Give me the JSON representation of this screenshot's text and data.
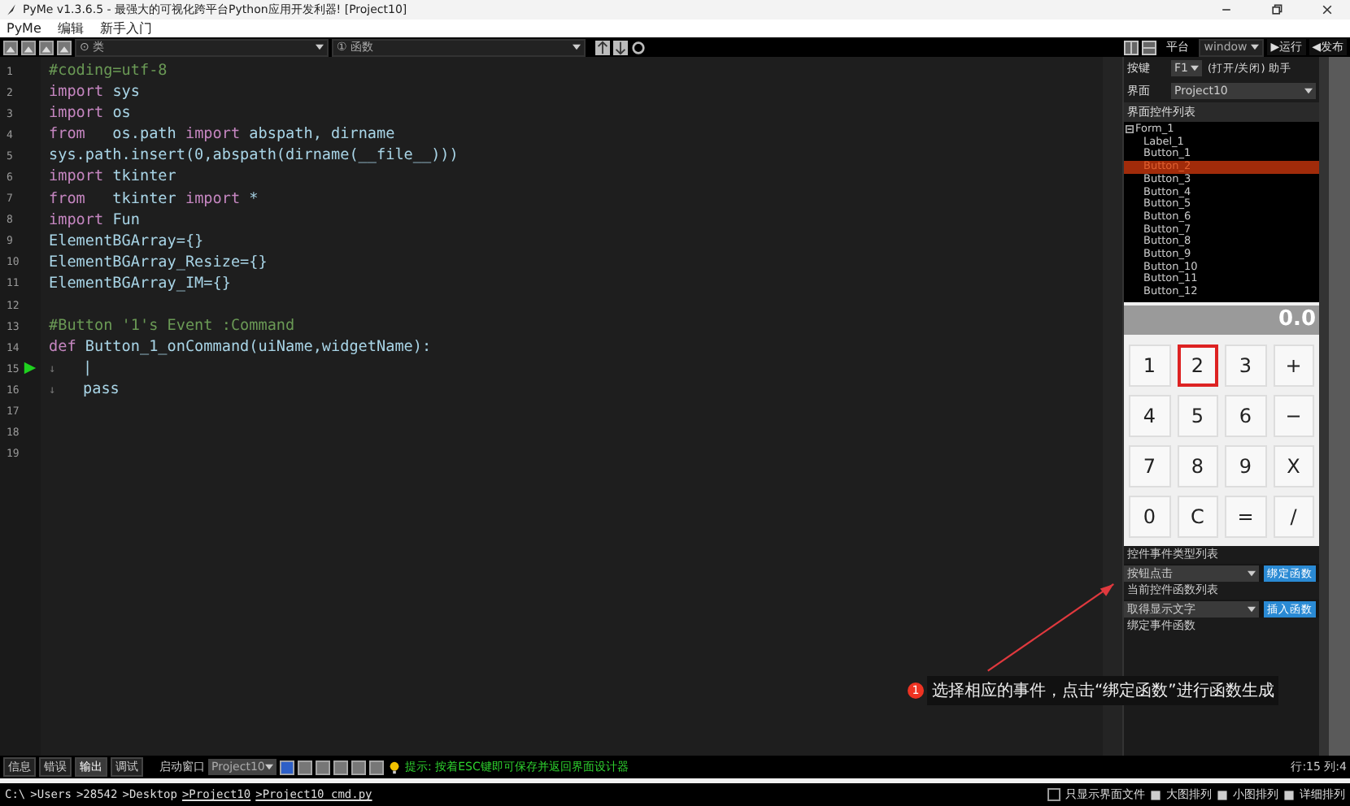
{
  "window": {
    "title": "PyMe v1.3.6.5 - 最强大的可视化跨平台Python应用开发利器!  [Project10]"
  },
  "menu": [
    "PyMe",
    "编辑",
    "新手入门"
  ],
  "toolbar": {
    "class_select": "⊙ 类",
    "function_select": "① 函数",
    "platform_label": "平台",
    "platform": "window",
    "run": "▶运行",
    "publish": "◀发布"
  },
  "editor": {
    "lines": [
      {
        "number": "1",
        "current": false,
        "code": [
          {
            "t": "#coding=utf-8",
            "kind": "comment"
          }
        ]
      },
      {
        "number": "2",
        "current": false,
        "code": [
          {
            "t": "import",
            "kind": "keyword"
          },
          {
            "t": " sys",
            "kind": "text"
          }
        ]
      },
      {
        "number": "3",
        "current": false,
        "code": [
          {
            "t": "import",
            "kind": "keyword"
          },
          {
            "t": " os",
            "kind": "text"
          }
        ]
      },
      {
        "number": "4",
        "current": false,
        "code": [
          {
            "t": "from",
            "kind": "keyword"
          },
          {
            "t": "   os.path ",
            "kind": "text"
          },
          {
            "t": "import",
            "kind": "keyword"
          },
          {
            "t": " abspath, dirname",
            "kind": "text"
          }
        ]
      },
      {
        "number": "5",
        "current": false,
        "code": [
          {
            "t": "sys.path.insert(0,abspath(dirname(__file__)))",
            "kind": "text"
          }
        ]
      },
      {
        "number": "6",
        "current": false,
        "code": [
          {
            "t": "import",
            "kind": "keyword"
          },
          {
            "t": " tkinter",
            "kind": "text"
          }
        ]
      },
      {
        "number": "7",
        "current": false,
        "code": [
          {
            "t": "from",
            "kind": "keyword"
          },
          {
            "t": "   tkinter ",
            "kind": "text"
          },
          {
            "t": "import",
            "kind": "keyword"
          },
          {
            "t": " *",
            "kind": "text"
          }
        ]
      },
      {
        "number": "8",
        "current": false,
        "code": [
          {
            "t": "import",
            "kind": "keyword"
          },
          {
            "t": " Fun",
            "kind": "text"
          }
        ]
      },
      {
        "number": "9",
        "current": false,
        "code": [
          {
            "t": "ElementBGArray={}",
            "kind": "text"
          }
        ]
      },
      {
        "number": "10",
        "current": false,
        "code": [
          {
            "t": "ElementBGArray_Resize={}",
            "kind": "text"
          }
        ]
      },
      {
        "number": "11",
        "current": false,
        "code": [
          {
            "t": "ElementBGArray_IM={}",
            "kind": "text"
          }
        ]
      },
      {
        "number": "12",
        "current": false
      },
      {
        "number": "13",
        "current": false,
        "code": [
          {
            "t": "#Button '1's Event :Command",
            "kind": "comment"
          }
        ]
      },
      {
        "number": "14",
        "current": false,
        "code": [
          {
            "t": "def",
            "kind": "keyword"
          },
          {
            "t": " Button_1_onCommand(uiName,widgetName):",
            "kind": "text"
          }
        ]
      },
      {
        "number": "15",
        "current": true,
        "code": [
          {
            "t": "↓",
            "kind": "tab"
          },
          {
            "t": "   |",
            "kind": "text"
          }
        ]
      },
      {
        "number": "16",
        "current": false,
        "code": [
          {
            "t": "↓",
            "kind": "tab"
          },
          {
            "t": "   pass",
            "kind": "text"
          }
        ]
      },
      {
        "number": "17",
        "current": false
      },
      {
        "number": "18",
        "current": false
      },
      {
        "number": "19",
        "current": false
      }
    ]
  },
  "panel": {
    "hotkey_label": "按键",
    "hotkey": "F1",
    "hotkey_hint": "(打开/关闭) 助手",
    "ui_label": "界面",
    "ui": "Project10",
    "tree_title": "界面控件列表",
    "tree": [
      {
        "label": "Form_1",
        "expanded": true,
        "selected": false,
        "children": [
          {
            "label": "Label_1",
            "selected": false
          },
          {
            "label": "Button_1",
            "selected": false
          },
          {
            "label": "Button_2",
            "selected": true
          },
          {
            "label": "Button_3",
            "selected": false
          },
          {
            "label": "Button_4",
            "selected": false
          },
          {
            "label": "Button_5",
            "selected": false
          },
          {
            "label": "Button_6",
            "selected": false
          },
          {
            "label": "Button_7",
            "selected": false
          },
          {
            "label": "Button_8",
            "selected": false
          },
          {
            "label": "Button_9",
            "selected": false
          },
          {
            "label": "Button_10",
            "selected": false
          },
          {
            "label": "Button_11",
            "selected": false
          },
          {
            "label": "Button_12",
            "selected": false
          }
        ]
      }
    ],
    "preview": {
      "display": "0.0",
      "keys": [
        {
          "label": "1",
          "selected": false
        },
        {
          "label": "2",
          "selected": true
        },
        {
          "label": "3",
          "selected": false
        },
        {
          "label": "+",
          "selected": false
        },
        {
          "label": "4",
          "selected": false
        },
        {
          "label": "5",
          "selected": false
        },
        {
          "label": "6",
          "selected": false
        },
        {
          "label": "−",
          "selected": false
        },
        {
          "label": "7",
          "selected": false
        },
        {
          "label": "8",
          "selected": false
        },
        {
          "label": "9",
          "selected": false
        },
        {
          "label": "X",
          "selected": false
        },
        {
          "label": "0",
          "selected": false
        },
        {
          "label": "C",
          "selected": false
        },
        {
          "label": "=",
          "selected": false
        },
        {
          "label": "/",
          "selected": false
        }
      ]
    },
    "event_list_title": "控件事件类型列表",
    "event": "按钮点击",
    "bind_button": "绑定函数",
    "function_list_title": "当前控件函数列表",
    "function": "取得显示文字",
    "insert_button": "插入函数",
    "bound_title": "绑定事件函数"
  },
  "callout": {
    "number": "1",
    "text": "选择相应的事件，点击“绑定函数”进行函数生成"
  },
  "bottom": {
    "tabs": [
      {
        "label": "信息",
        "selected": false
      },
      {
        "label": "错误",
        "selected": false
      },
      {
        "label": "输出",
        "selected": true
      },
      {
        "label": "调试",
        "selected": false
      }
    ],
    "startup_label": "启动窗口",
    "startup": "Project10",
    "hint": "提示: 按着ESC键即可保存并返回界面设计器",
    "position": "行:15 列:4"
  },
  "path": [
    {
      "text": "C:\\",
      "link": false
    },
    {
      "text": ">Users",
      "link": false
    },
    {
      "text": ">28542",
      "link": false
    },
    {
      "text": ">Desktop",
      "link": false
    },
    {
      "text": ">Project10",
      "link": true
    },
    {
      "text": ">Project10_cmd.py",
      "link": true
    }
  ],
  "view_options": {
    "only_ui_files": {
      "label": "只显示界面文件",
      "checked": false
    },
    "views": [
      "大图排列",
      "小图排列",
      "详细排列"
    ]
  }
}
